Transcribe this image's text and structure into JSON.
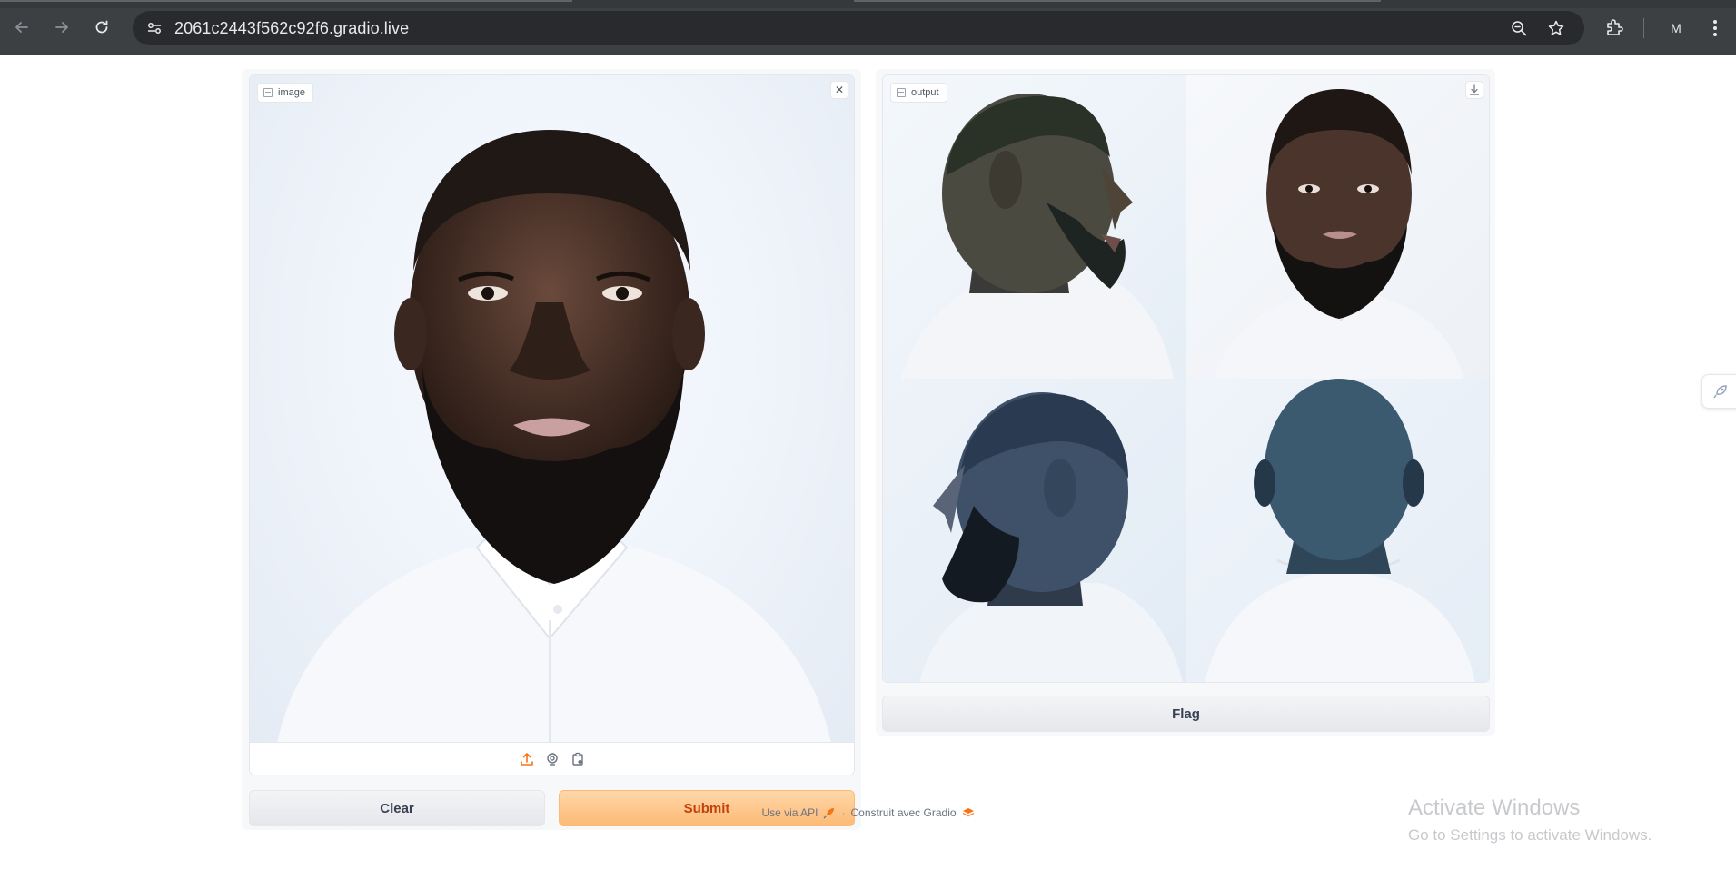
{
  "browser": {
    "url": "2061c2443f562c92f6.gradio.live",
    "profile_initial": "M"
  },
  "input_panel": {
    "label": "image",
    "clear_label": "Clear",
    "submit_label": "Submit"
  },
  "output_panel": {
    "label": "output",
    "flag_label": "Flag"
  },
  "footer": {
    "api_text": "Use via API",
    "separator": "·",
    "built_with": "Construit avec Gradio"
  },
  "watermark": {
    "title": "Activate Windows",
    "subtitle": "Go to Settings to activate Windows."
  },
  "colors": {
    "primary_button_text": "#c2410c",
    "primary_button_bg": "#fdba74",
    "chrome_bg": "#3c4043"
  }
}
